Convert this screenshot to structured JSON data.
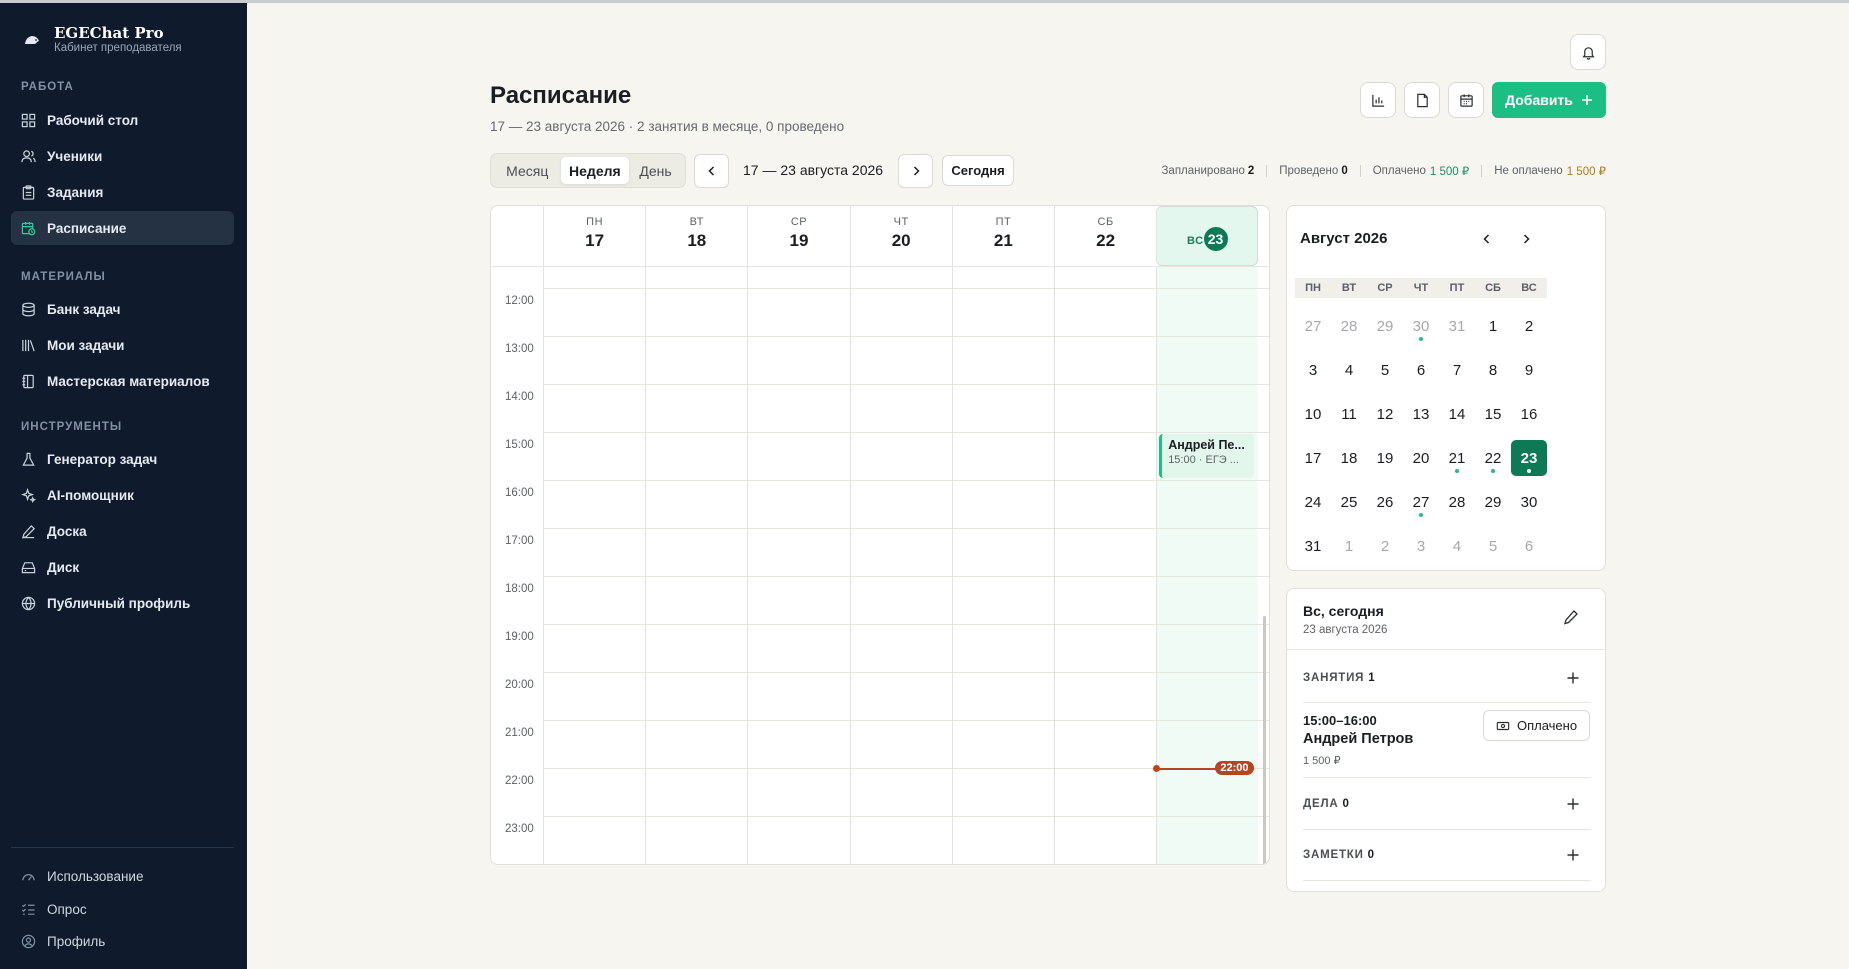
{
  "app": {
    "name": "EGEChat Pro",
    "subtitle": "Кабинет преподавателя"
  },
  "sidebar": {
    "sections": [
      {
        "title": "Работа",
        "items": [
          {
            "label": "Рабочий стол",
            "icon": "grid-icon"
          },
          {
            "label": "Ученики",
            "icon": "users-icon"
          },
          {
            "label": "Задания",
            "icon": "clipboard-icon"
          },
          {
            "label": "Расписание",
            "icon": "calendar-icon",
            "active": true
          }
        ]
      },
      {
        "title": "Материалы",
        "items": [
          {
            "label": "Банк задач",
            "icon": "database-icon"
          },
          {
            "label": "Мои задачи",
            "icon": "library-icon"
          },
          {
            "label": "Мастерская материалов",
            "icon": "notebook-icon"
          }
        ]
      },
      {
        "title": "Инструменты",
        "items": [
          {
            "label": "Генератор задач",
            "icon": "flask-icon"
          },
          {
            "label": "AI-помощник",
            "icon": "sparkles-icon"
          },
          {
            "label": "Доска",
            "icon": "pen-icon"
          },
          {
            "label": "Диск",
            "icon": "drive-icon"
          },
          {
            "label": "Публичный профиль",
            "icon": "globe-icon"
          }
        ]
      }
    ],
    "bottom": [
      {
        "label": "Использование",
        "icon": "gauge-icon"
      },
      {
        "label": "Опрос",
        "icon": "list-check-icon"
      },
      {
        "label": "Профиль",
        "icon": "user-circle-icon"
      }
    ]
  },
  "header": {
    "title": "Расписание",
    "subtitle": "17 — 23 августа 2026 · 2 занятия в месяце, 0 проведено",
    "add_label": "Добавить"
  },
  "toolbar": {
    "views": [
      "Месяц",
      "Неделя",
      "День"
    ],
    "active_view": "Неделя",
    "range": "17 — 23 августа 2026",
    "today_label": "Сегодня"
  },
  "stats": {
    "planned_label": "Запланировано",
    "planned": "2",
    "done_label": "Проведено",
    "done": "0",
    "paid_label": "Оплачено",
    "paid": "1 500 ₽",
    "unpaid_label": "Не оплачено",
    "unpaid": "1 500 ₽"
  },
  "week": {
    "days": [
      {
        "name": "ПН",
        "date": "17"
      },
      {
        "name": "ВТ",
        "date": "18"
      },
      {
        "name": "СР",
        "date": "19"
      },
      {
        "name": "ЧТ",
        "date": "20"
      },
      {
        "name": "ПТ",
        "date": "21"
      },
      {
        "name": "СБ",
        "date": "22"
      },
      {
        "name": "ВС",
        "date": "23",
        "today": true
      }
    ],
    "hours": [
      "12:00",
      "13:00",
      "14:00",
      "15:00",
      "16:00",
      "17:00",
      "18:00",
      "19:00",
      "20:00",
      "21:00",
      "22:00",
      "23:00"
    ],
    "events": [
      {
        "day": 6,
        "start": "15:00",
        "name": "Андрей Пе...",
        "sub": "15:00 · ЕГЭ ..."
      }
    ],
    "now": "22:00"
  },
  "minical": {
    "title": "Август 2026",
    "weekdays": [
      "ПН",
      "ВТ",
      "СР",
      "ЧТ",
      "ПТ",
      "СБ",
      "ВС"
    ],
    "days": [
      {
        "d": "27",
        "out": true
      },
      {
        "d": "28",
        "out": true
      },
      {
        "d": "29",
        "out": true
      },
      {
        "d": "30",
        "out": true,
        "dot": true
      },
      {
        "d": "31",
        "out": true
      },
      {
        "d": "1"
      },
      {
        "d": "2"
      },
      {
        "d": "3"
      },
      {
        "d": "4"
      },
      {
        "d": "5"
      },
      {
        "d": "6"
      },
      {
        "d": "7"
      },
      {
        "d": "8"
      },
      {
        "d": "9"
      },
      {
        "d": "10"
      },
      {
        "d": "11"
      },
      {
        "d": "12"
      },
      {
        "d": "13"
      },
      {
        "d": "14"
      },
      {
        "d": "15"
      },
      {
        "d": "16"
      },
      {
        "d": "17"
      },
      {
        "d": "18"
      },
      {
        "d": "19"
      },
      {
        "d": "20"
      },
      {
        "d": "21",
        "dot": true
      },
      {
        "d": "22",
        "dot": true
      },
      {
        "d": "23",
        "sel": true,
        "dot": true
      },
      {
        "d": "24"
      },
      {
        "d": "25"
      },
      {
        "d": "26"
      },
      {
        "d": "27",
        "dot": true
      },
      {
        "d": "28"
      },
      {
        "d": "29"
      },
      {
        "d": "30"
      },
      {
        "d": "31"
      },
      {
        "d": "1",
        "out": true
      },
      {
        "d": "2",
        "out": true
      },
      {
        "d": "3",
        "out": true
      },
      {
        "d": "4",
        "out": true
      },
      {
        "d": "5",
        "out": true
      },
      {
        "d": "6",
        "out": true
      }
    ]
  },
  "day_panel": {
    "title": "Вс, сегодня",
    "date": "23 августа 2026",
    "lessons_label": "ЗАНЯТИЯ",
    "lessons_count": "1",
    "lesson": {
      "time": "15:00–16:00",
      "name": "Андрей Петров",
      "price": "1 500 ₽",
      "status": "Оплачено"
    },
    "tasks_label": "ДЕЛА",
    "tasks_count": "0",
    "notes_label": "ЗАМЕТКИ",
    "notes_count": "0"
  },
  "colors": {
    "accent": "#1bbf84",
    "dark_green": "#0e7a55",
    "sidebar_bg": "#0f1b2d",
    "now_line": "#b8461c"
  }
}
